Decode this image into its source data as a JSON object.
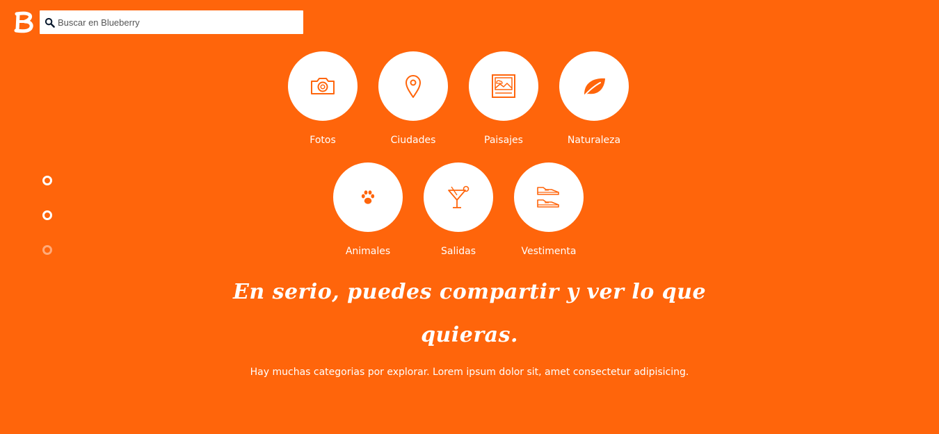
{
  "brand": {
    "logo_letter": "B",
    "accent_color": "#ff650b"
  },
  "search": {
    "icon": "search-icon",
    "placeholder": "Buscar en Blueberry",
    "value": ""
  },
  "categories": [
    {
      "label": "Fotos",
      "icon": "camera-icon"
    },
    {
      "label": "Ciudades",
      "icon": "map-pin-icon"
    },
    {
      "label": "Paisajes",
      "icon": "landscape-image-icon"
    },
    {
      "label": "Naturaleza",
      "icon": "leaf-icon"
    },
    {
      "label": "Animales",
      "icon": "paw-icon"
    },
    {
      "label": "Salidas",
      "icon": "cocktail-icon"
    },
    {
      "label": "Vestimenta",
      "icon": "sneakers-icon"
    }
  ],
  "pager": {
    "dots": 3,
    "states": [
      "active",
      "active",
      "inactive"
    ]
  },
  "hero": {
    "headline": "En serio, puedes compartir y ver lo que quieras.",
    "subtitle": "Hay muchas categorias por explorar. Lorem ipsum dolor sit, amet consectetur adipisicing."
  }
}
